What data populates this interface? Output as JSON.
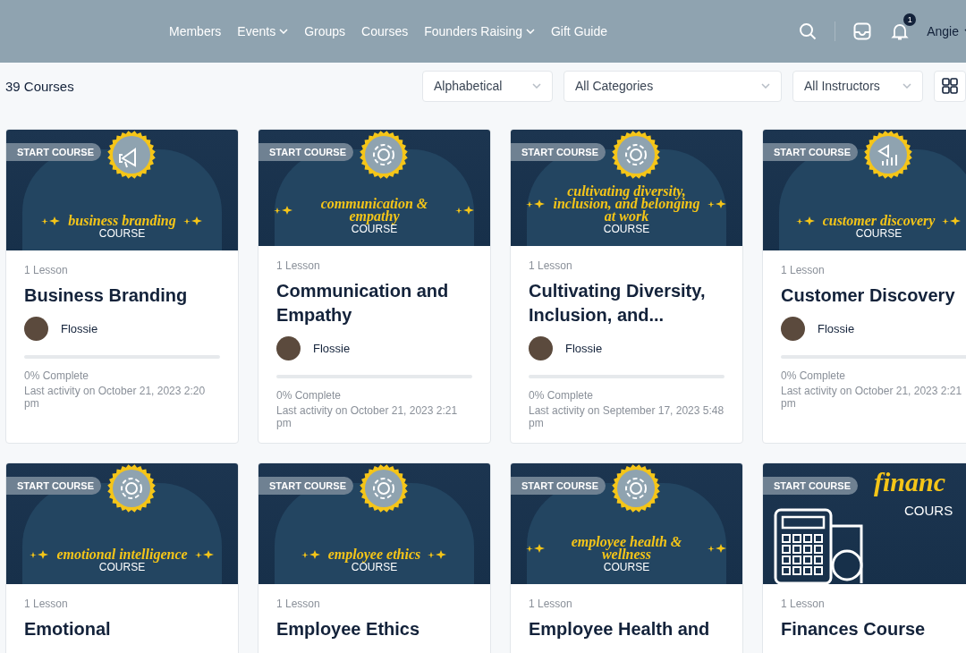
{
  "nav": {
    "links": [
      {
        "label": "Members",
        "dropdown": false
      },
      {
        "label": "Events",
        "dropdown": true
      },
      {
        "label": "Groups",
        "dropdown": false
      },
      {
        "label": "Courses",
        "dropdown": false
      },
      {
        "label": "Founders Raising",
        "dropdown": true
      },
      {
        "label": "Gift Guide",
        "dropdown": false
      }
    ],
    "notification_count": "1",
    "user": "Angie"
  },
  "toolbar": {
    "count": "39 Courses",
    "filters": [
      "Alphabetical",
      "All Categories",
      "All Instructors"
    ]
  },
  "courses": [
    {
      "cover": {
        "kind": "megaphone",
        "badge": "START COURSE",
        "title": "business branding",
        "subtitle": "COURSE"
      },
      "lessons": "1 Lesson",
      "title": "Business Branding",
      "author": "Flossie",
      "progress": {
        "level": 0,
        "label": "0% Complete"
      },
      "activity": "Last activity on October 21, 2023 2:20 pm"
    },
    {
      "cover": {
        "kind": "gear",
        "badge": "START COURSE",
        "title": "communication & empathy",
        "subtitle": "COURSE"
      },
      "lessons": "1 Lesson",
      "title": "Communication and Empathy",
      "author": "Flossie",
      "progress": {
        "level": 0,
        "label": "0% Complete"
      },
      "activity": "Last activity on October 21, 2023 2:21 pm"
    },
    {
      "cover": {
        "kind": "gear",
        "badge": "START COURSE",
        "title": "cultivating diversity, inclusion, and belonging at work",
        "subtitle": "COURSE"
      },
      "lessons": "1 Lesson",
      "title": "Cultivating Diversity, Inclusion, and...",
      "author": "Flossie",
      "progress": {
        "level": 0,
        "label": "0% Complete"
      },
      "activity": "Last activity on September 17, 2023 5:48 pm"
    },
    {
      "cover": {
        "kind": "chart",
        "badge": "START COURSE",
        "title": "customer discovery",
        "subtitle": "COURSE"
      },
      "lessons": "1 Lesson",
      "title": "Customer Discovery",
      "author": "Flossie",
      "progress": {
        "level": 0,
        "label": "0% Complete"
      },
      "activity": "Last activity on October 21, 2023 2:21 pm"
    },
    {
      "cover": {
        "kind": "gear",
        "badge": "START COURSE",
        "title": "emotional intelligence",
        "subtitle": "COURSE"
      },
      "lessons": "1 Lesson",
      "title": "Emotional"
    },
    {
      "cover": {
        "kind": "gear",
        "badge": "START COURSE",
        "title": "employee ethics",
        "subtitle": "COURSE"
      },
      "lessons": "1 Lesson",
      "title": "Employee Ethics"
    },
    {
      "cover": {
        "kind": "gear",
        "badge": "START COURSE",
        "title": "employee health & wellness",
        "subtitle": "COURSE"
      },
      "lessons": "1 Lesson",
      "title": "Employee Health and"
    },
    {
      "cover": {
        "kind": "calculator",
        "badge": "START COURSE",
        "title": "financ",
        "subtitle": "COURS"
      },
      "lessons": "1 Lesson",
      "title": "Finances Course"
    }
  ]
}
